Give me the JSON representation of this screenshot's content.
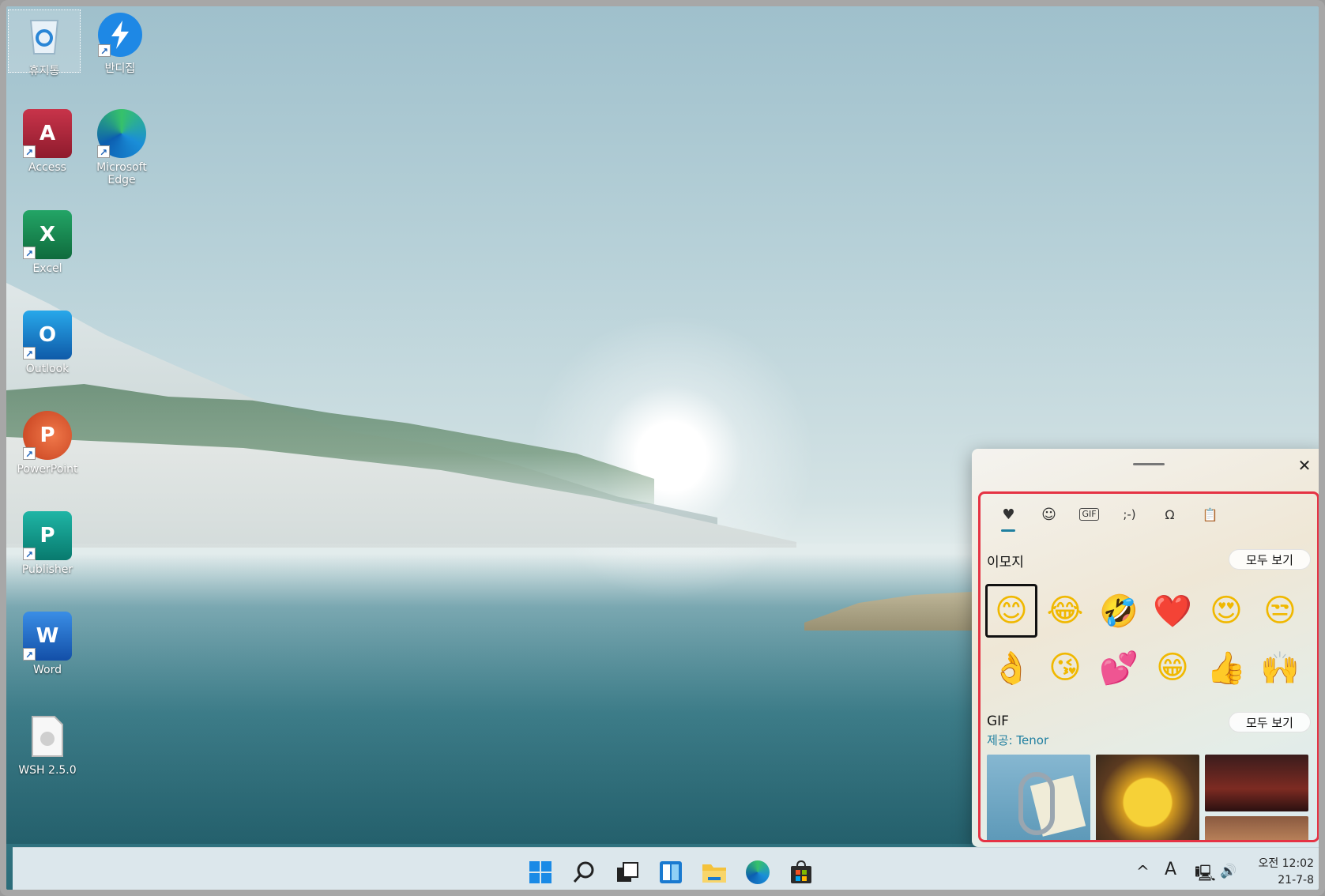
{
  "desktop": {
    "icons": [
      {
        "label": "휴지통",
        "name": "recycle-bin"
      },
      {
        "label": "반디집",
        "name": "bandizip"
      },
      {
        "label": "Access",
        "name": "access"
      },
      {
        "label": "Microsoft Edge",
        "name": "microsoft-edge"
      },
      {
        "label": "Excel",
        "name": "excel"
      },
      {
        "label": "Outlook",
        "name": "outlook"
      },
      {
        "label": "PowerPoint",
        "name": "powerpoint"
      },
      {
        "label": "Publisher",
        "name": "publisher"
      },
      {
        "label": "Word",
        "name": "word"
      },
      {
        "label": "WSH 2.5.0",
        "name": "wsh"
      }
    ],
    "glyphs": {
      "access": "A",
      "excel": "X",
      "outlook": "O",
      "powerpoint": "P",
      "publisher": "P",
      "word": "W",
      "shortcut": "↗"
    }
  },
  "emoji_panel": {
    "close_glyph": "✕",
    "tabs": [
      {
        "name": "recent",
        "glyph": "♥"
      },
      {
        "name": "emoji",
        "glyph": "☺"
      },
      {
        "name": "gif",
        "glyph": "GIF"
      },
      {
        "name": "kaomoji",
        "glyph": ";-)"
      },
      {
        "name": "symbols",
        "glyph": "Ω"
      },
      {
        "name": "clipboard",
        "glyph": "📋"
      }
    ],
    "emoji_section": {
      "title": "이모지",
      "see_all": "모두 보기"
    },
    "emojis": [
      "😊",
      "😂",
      "🤣",
      "❤️",
      "😍",
      "😒",
      "👌",
      "😘",
      "💕",
      "😁",
      "👍",
      "🙌"
    ],
    "gif_section": {
      "title": "GIF",
      "see_all": "모두 보기",
      "provider": "제공: Tenor"
    }
  },
  "taskbar": {
    "icons": [
      "start",
      "search",
      "task-view",
      "widgets",
      "file-explorer",
      "edge",
      "store"
    ],
    "tray": {
      "chevron": "^",
      "ime": "A",
      "network": "🖳",
      "volume": "🔊"
    },
    "clock": {
      "time": "오전 12:02",
      "date": "21-7-8"
    }
  },
  "colors": {
    "highlight": "#e53344",
    "accent": "#1f7fa0"
  }
}
